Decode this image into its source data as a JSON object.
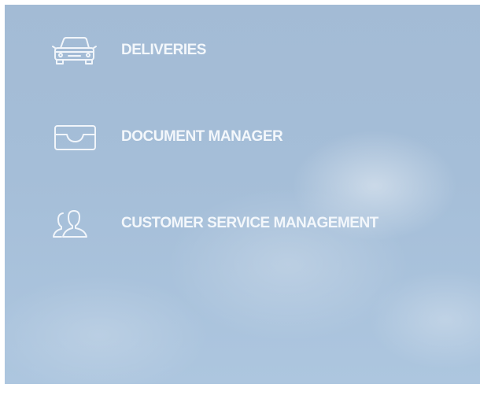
{
  "nav": {
    "items": [
      {
        "label": "DELIVERIES",
        "icon": "car-icon"
      },
      {
        "label": "DOCUMENT MANAGER",
        "icon": "inbox-tray-icon"
      },
      {
        "label": "CUSTOMER SERVICE MANAGEMENT",
        "icon": "users-icon"
      }
    ]
  },
  "colors": {
    "background": "#a5bed8",
    "text": "#f3f7fb",
    "page": "#ffffff"
  }
}
